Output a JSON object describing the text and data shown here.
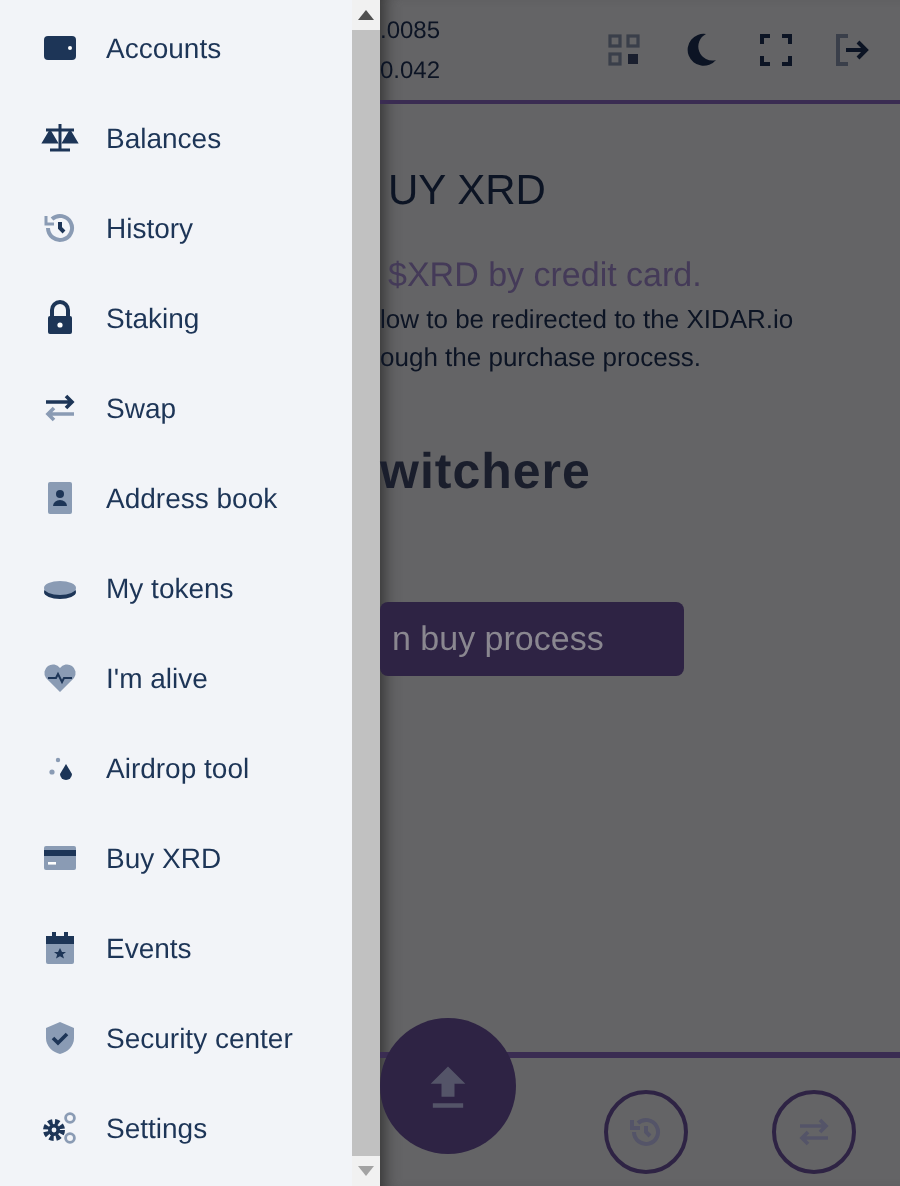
{
  "menu": [
    {
      "kind": "wallet",
      "label": "Accounts"
    },
    {
      "kind": "scale",
      "label": "Balances"
    },
    {
      "kind": "history",
      "label": "History"
    },
    {
      "kind": "lock",
      "label": "Staking"
    },
    {
      "kind": "swap",
      "label": "Swap"
    },
    {
      "kind": "contact",
      "label": "Address book"
    },
    {
      "kind": "coins",
      "label": "My tokens"
    },
    {
      "kind": "heart",
      "label": "I'm alive"
    },
    {
      "kind": "drops",
      "label": "Airdrop tool"
    },
    {
      "kind": "card",
      "label": "Buy XRD"
    },
    {
      "kind": "calendar",
      "label": "Events"
    },
    {
      "kind": "shield",
      "label": "Security center"
    },
    {
      "kind": "gears",
      "label": "Settings"
    }
  ],
  "header": {
    "balances": [
      ".0085",
      "0.042"
    ]
  },
  "page": {
    "title": "UY XRD",
    "subtitle": "$XRD by credit card.",
    "description": [
      "low to be redirected to the XIDAR.io",
      "ough the purchase process."
    ],
    "provider": "witchere",
    "button": "n buy process"
  }
}
